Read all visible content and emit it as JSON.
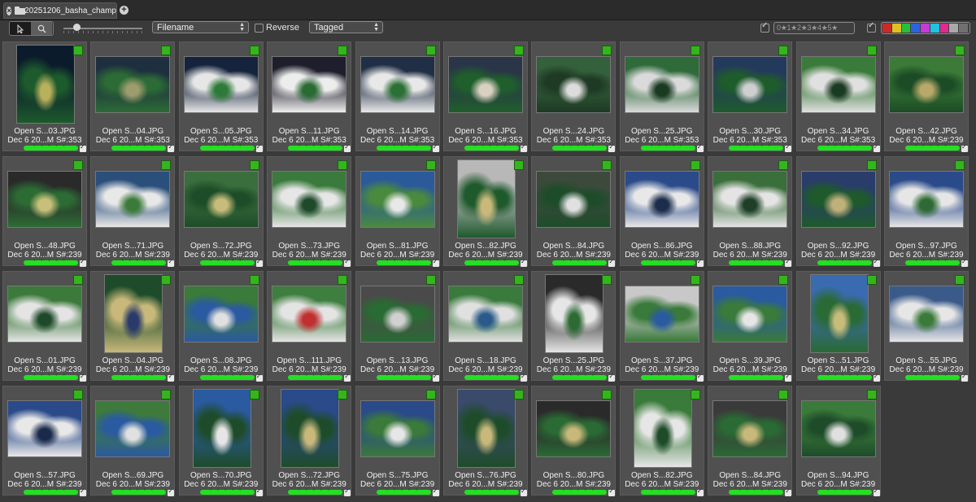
{
  "tab": {
    "title": "20251206_basha_champ"
  },
  "toolbar": {
    "sort_field": "Filename",
    "reverse_label": "Reverse",
    "filter": "Tagged",
    "stars_label": "0★1★2★3★4★5★",
    "color_labels": [
      "#cc2a2a",
      "#e0c020",
      "#28c03a",
      "#2a64e0",
      "#c83ad8",
      "#20c4e0",
      "#e02a8c",
      "#a8a8a8",
      "#707070"
    ]
  },
  "photos": [
    {
      "name": "Open S...03.JPG",
      "meta": "Dec 6 20...M S#:353",
      "colors": [
        "#0b1b2c",
        "#1d5a2c",
        "#b8b05c"
      ],
      "portrait": true
    },
    {
      "name": "Open S...04.JPG",
      "meta": "Dec 6 20...M S#:353",
      "colors": [
        "#1e2f3f",
        "#2c6b35",
        "#9c9c6c"
      ]
    },
    {
      "name": "Open S...05.JPG",
      "meta": "Dec 6 20...M S#:353",
      "colors": [
        "#15243c",
        "#e6e6e6",
        "#2e7a3a"
      ]
    },
    {
      "name": "Open S...11.JPG",
      "meta": "Dec 6 20...M S#:353",
      "colors": [
        "#1e1e2c",
        "#ededed",
        "#2a6b34"
      ]
    },
    {
      "name": "Open S...14.JPG",
      "meta": "Dec 6 20...M S#:353",
      "colors": [
        "#202f46",
        "#e8e8e8",
        "#2b7034"
      ]
    },
    {
      "name": "Open S...16.JPG",
      "meta": "Dec 6 20...M S#:353",
      "colors": [
        "#2a3548",
        "#1f5f2b",
        "#d8d0c0"
      ]
    },
    {
      "name": "Open S...24.JPG",
      "meta": "Dec 6 20...M S#:353",
      "colors": [
        "#34603c",
        "#1e3a24",
        "#dcdcdc"
      ]
    },
    {
      "name": "Open S...25.JPG",
      "meta": "Dec 6 20...M S#:353",
      "colors": [
        "#2e6a3a",
        "#dadada",
        "#1a3a22"
      ]
    },
    {
      "name": "Open S...30.JPG",
      "meta": "Dec 6 20...M S#:353",
      "colors": [
        "#243a5c",
        "#1e5c2c",
        "#cfcfcf"
      ]
    },
    {
      "name": "Open S...34.JPG",
      "meta": "Dec 6 20...M S#:353",
      "colors": [
        "#3a7a3a",
        "#e0e0e0",
        "#1a3a22"
      ]
    },
    {
      "name": "Open S...42.JPG",
      "meta": "Dec 6 20...M S#:239",
      "colors": [
        "#3c7a38",
        "#1c4c26",
        "#b8a86a"
      ]
    },
    {
      "name": "Open S...48.JPG",
      "meta": "Dec 6 20...M S#:239",
      "colors": [
        "#2a2a2a",
        "#2c6c34",
        "#c8c07a"
      ]
    },
    {
      "name": "Open S...71.JPG",
      "meta": "Dec 6 20...M S#:239",
      "colors": [
        "#2a4f7a",
        "#e8e8e8",
        "#3c7a3a"
      ]
    },
    {
      "name": "Open S...72.JPG",
      "meta": "Dec 6 20...M S#:239",
      "colors": [
        "#3a6e3c",
        "#1d4c28",
        "#c8bc7c"
      ]
    },
    {
      "name": "Open S...73.JPG",
      "meta": "Dec 6 20...M S#:239",
      "colors": [
        "#3a7a3c",
        "#e6e6e6",
        "#1e4a2a"
      ]
    },
    {
      "name": "Open S...81.JPG",
      "meta": "Dec 6 20...M S#:239",
      "colors": [
        "#2a5a9a",
        "#4a8a3e",
        "#e8e8e8"
      ]
    },
    {
      "name": "Open S...82.JPG",
      "meta": "Dec 6 20...M S#:239",
      "colors": [
        "#b8b8b8",
        "#1e5a2c",
        "#c8b87a"
      ],
      "portrait": true
    },
    {
      "name": "Open S...84.JPG",
      "meta": "Dec 6 20...M S#:239",
      "colors": [
        "#3c4a3c",
        "#1e4c2a",
        "#e0e0e0"
      ]
    },
    {
      "name": "Open S...86.JPG",
      "meta": "Dec 6 20...M S#:239",
      "colors": [
        "#2a4a8a",
        "#e8e8e8",
        "#1c2c4c"
      ]
    },
    {
      "name": "Open S...88.JPG",
      "meta": "Dec 6 20...M S#:239",
      "colors": [
        "#3a6e3a",
        "#e4e4e4",
        "#1e3e28"
      ]
    },
    {
      "name": "Open S...92.JPG",
      "meta": "Dec 6 20...M S#:239",
      "colors": [
        "#2a3c6a",
        "#1e5a2c",
        "#c0b07a"
      ]
    },
    {
      "name": "Open S...97.JPG",
      "meta": "Dec 6 20...M S#:239",
      "colors": [
        "#2a4a8a",
        "#e6e6e6",
        "#2e6a36"
      ]
    },
    {
      "name": "Open S...01.JPG",
      "meta": "Dec 6 20...M S#:239",
      "colors": [
        "#3c7a3c",
        "#e4e4e4",
        "#1e4a2a"
      ]
    },
    {
      "name": "Open S...04.JPG",
      "meta": "Dec 6 20...M S#:239",
      "colors": [
        "#1e4c2a",
        "#c8b87a",
        "#2a3a6a"
      ],
      "portrait": true
    },
    {
      "name": "Open S...08.JPG",
      "meta": "Dec 6 20...M S#:239",
      "colors": [
        "#3a7a3a",
        "#2a5aa0",
        "#e0e0e0"
      ]
    },
    {
      "name": "Open S...111.JPG",
      "meta": "Dec 6 20...M S#:239",
      "colors": [
        "#3e7e3e",
        "#e4e4e4",
        "#c03030"
      ]
    },
    {
      "name": "Open S...13.JPG",
      "meta": "Dec 6 20...M S#:239",
      "colors": [
        "#4a4a4a",
        "#2a6a34",
        "#d0d0d0"
      ]
    },
    {
      "name": "Open S...18.JPG",
      "meta": "Dec 6 20...M S#:239",
      "colors": [
        "#3a7a3c",
        "#e0e0e0",
        "#2a5a8a"
      ]
    },
    {
      "name": "Open S...25.JPG",
      "meta": "Dec 6 20...M S#:239",
      "colors": [
        "#2a2a2a",
        "#e6e6e6",
        "#2e6a34"
      ],
      "portrait": true
    },
    {
      "name": "Open S...37.JPG",
      "meta": "Dec 6 20...M S#:239",
      "colors": [
        "#c8c8c8",
        "#3a7a3a",
        "#2a5aa0"
      ]
    },
    {
      "name": "Open S...39.JPG",
      "meta": "Dec 6 20...M S#:239",
      "colors": [
        "#2a5aa0",
        "#3a7a3a",
        "#e6e6e6"
      ]
    },
    {
      "name": "Open S...51.JPG",
      "meta": "Dec 6 20...M S#:239",
      "colors": [
        "#3a6ab0",
        "#2a6a34",
        "#c8bc7a"
      ],
      "portrait": true
    },
    {
      "name": "Open S...55.JPG",
      "meta": "Dec 6 20...M S#:239",
      "colors": [
        "#3a5a8a",
        "#e6e6e6",
        "#3a7a3a"
      ]
    },
    {
      "name": "Open S...57.JPG",
      "meta": "Dec 6 20...M S#:239",
      "colors": [
        "#2a4a8a",
        "#e8e8e8",
        "#1a2a4a"
      ]
    },
    {
      "name": "Open S...69.JPG",
      "meta": "Dec 6 20...M S#:239",
      "colors": [
        "#3e7a3c",
        "#2a5aa0",
        "#e0e0e0"
      ]
    },
    {
      "name": "Open S...70.JPG",
      "meta": "Dec 6 20...M S#:239",
      "colors": [
        "#2a5aa0",
        "#1e4c2a",
        "#e6e6e6"
      ],
      "portrait": true
    },
    {
      "name": "Open S...72.JPG",
      "meta": "Dec 6 20...M S#:239",
      "colors": [
        "#2a4a8a",
        "#1e4c2a",
        "#c8b87a"
      ],
      "portrait": true
    },
    {
      "name": "Open S...75.JPG",
      "meta": "Dec 6 20...M S#:239",
      "colors": [
        "#2a4a8a",
        "#3a7a3a",
        "#e6e6e6"
      ]
    },
    {
      "name": "Open S...76.JPG",
      "meta": "Dec 6 20...M S#:239",
      "colors": [
        "#3a4a6a",
        "#1e4c2a",
        "#c8b87a"
      ],
      "portrait": true
    },
    {
      "name": "Open S...80.JPG",
      "meta": "Dec 6 20...M S#:239",
      "colors": [
        "#2a2a2a",
        "#2a6a34",
        "#c8b87a"
      ]
    },
    {
      "name": "Open S...82.JPG",
      "meta": "Dec 6 20...M S#:239",
      "colors": [
        "#3a7a3a",
        "#e6e6e6",
        "#1e4c2a"
      ],
      "portrait": true
    },
    {
      "name": "Open S...84.JPG",
      "meta": "Dec 6 20...M S#:239",
      "colors": [
        "#3a3a3a",
        "#2a6a34",
        "#c8b87a"
      ]
    },
    {
      "name": "Open S...94.JPG",
      "meta": "Dec 6 20...M S#:239",
      "colors": [
        "#3a7a3a",
        "#1e4c2a",
        "#e0e0e0"
      ]
    }
  ]
}
